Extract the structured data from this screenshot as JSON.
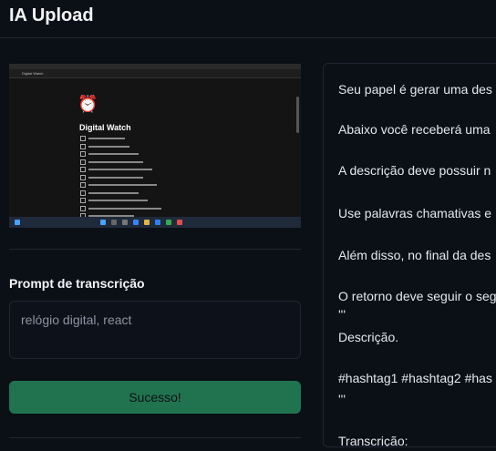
{
  "app": {
    "title": "IA Upload"
  },
  "preview": {
    "app_heading": "Digital Watch",
    "tab_title": "Digital Watch",
    "clock_glyph": "⏰",
    "task_count": 11
  },
  "transcription": {
    "label": "Prompt de transcrição",
    "value": "relógio digital, react"
  },
  "status_button": {
    "label": "Sucesso!"
  },
  "prompt_panel": {
    "lines": [
      "Seu papel é gerar uma des",
      "Abaixo você receberá uma",
      "A descrição deve possuir n",
      "Use palavras chamativas e",
      "Além disso, no final da des",
      "O retorno deve seguir o seg",
      "'''",
      "Descrição.",
      "#hashtag1 #hashtag2 #has",
      "'''",
      "Transcrição:"
    ]
  },
  "colors": {
    "background": "#0b1017",
    "button": "#21734f",
    "border": "#1f2631"
  }
}
